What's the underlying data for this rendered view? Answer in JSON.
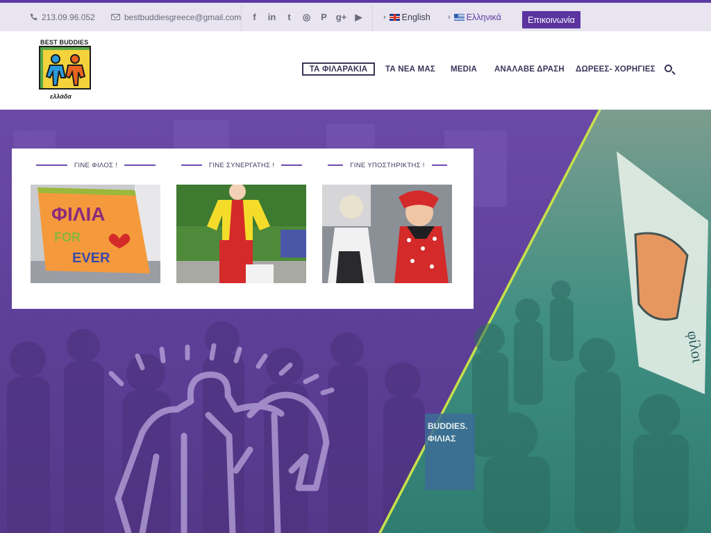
{
  "topbar": {
    "phone": "213.09.96.052",
    "email": "bestbuddiesgreece@gmail.com",
    "social": [
      {
        "name": "facebook-icon",
        "glyph": "f"
      },
      {
        "name": "linkedin-icon",
        "glyph": "in"
      },
      {
        "name": "twitter-icon",
        "glyph": "t"
      },
      {
        "name": "instagram-icon",
        "glyph": "◎"
      },
      {
        "name": "pinterest-icon",
        "glyph": "P"
      },
      {
        "name": "google-plus-icon",
        "glyph": "g+"
      },
      {
        "name": "youtube-icon",
        "glyph": "▶"
      }
    ],
    "lang_en": "English",
    "lang_el": "Ελληνικά",
    "contact_label": "Επικοινωνία"
  },
  "header": {
    "logo_top": "BEST BUDDIES",
    "logo_bottom": "ελλάδα",
    "nav": [
      "ΤΑ ΦΙΛΑΡΑΚΙΑ",
      "ΤΑ ΝΕΑ ΜΑΣ",
      "MEDIA",
      "ΑΝΑΛΑΒΕ ΔΡΑΣΗ",
      "ΔΩΡΕΕΣ- ΧΟΡΗΓΙΕΣ"
    ]
  },
  "card": {
    "columns": [
      {
        "title": "ΓΙΝΕ ΦΙΛΟΣ !",
        "image": "φιλια-for-ever-sign-photo"
      },
      {
        "title": "ΓΙΝΕ ΣΥΝΕΡΓΑΤΗΣ !",
        "image": "clown-costume-photo"
      },
      {
        "title": "ΓΙΝΕ ΥΠΟΣΤΗΡΙΚΤΗΣ !",
        "image": "face-painting-photo"
      }
    ],
    "sign_text": {
      "line1": "ΦΙΛΙΑ",
      "line2": "FOR",
      "line3": "EVER"
    }
  },
  "hero": {
    "banner_text": {
      "line1": "BUDDIES.",
      "line2": "ΦΙΛΙΑΣ"
    },
    "flag_text": "φίλοι"
  },
  "colors": {
    "accent": "#5b34a0",
    "hero_purple": "#5a3d8e",
    "hero_teal": "#3f8f82",
    "divider_lime": "#c8e04a",
    "nav_text": "#3a3458"
  }
}
